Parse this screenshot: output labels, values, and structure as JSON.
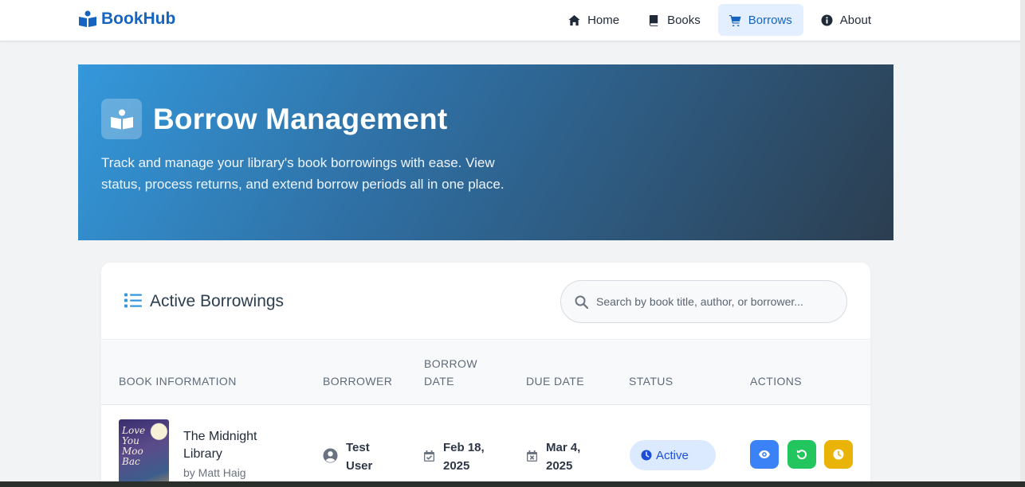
{
  "navbar": {
    "brand": "BookHub",
    "items": [
      {
        "label": "Home",
        "icon": "home-icon",
        "active": false
      },
      {
        "label": "Books",
        "icon": "book-icon",
        "active": false
      },
      {
        "label": "Borrows",
        "icon": "cart-icon",
        "active": true
      },
      {
        "label": "About",
        "icon": "info-icon",
        "active": false
      }
    ]
  },
  "hero": {
    "title": "Borrow Management",
    "description": "Track and manage your library's book borrowings with ease. View status, process returns, and extend borrow periods all in one place.",
    "icon": "open-book-icon"
  },
  "borrowings": {
    "title": "Active Borrowings",
    "search_placeholder": "Search by book title, author, or borrower...",
    "columns": [
      "Book Information",
      "Borrower",
      "Borrow Date",
      "Due Date",
      "Status",
      "Actions"
    ],
    "rows": [
      {
        "book_title": "The Midnight Library",
        "book_author": "by Matt Haig",
        "borrower": "Test User",
        "borrow_date": "Feb 18, 2025",
        "due_date": "Mar 4, 2025",
        "status": "Active",
        "actions": [
          {
            "icon": "eye-icon",
            "color": "#3b82f6"
          },
          {
            "icon": "return-icon",
            "color": "#22c55e"
          },
          {
            "icon": "clock-icon",
            "color": "#eab308"
          }
        ]
      }
    ]
  },
  "colors": {
    "brand": "#1565c0",
    "hero_start": "#3498db",
    "hero_end": "#2c3e50",
    "status_bg": "#dbeafe",
    "status_text": "#1d4ed8"
  }
}
